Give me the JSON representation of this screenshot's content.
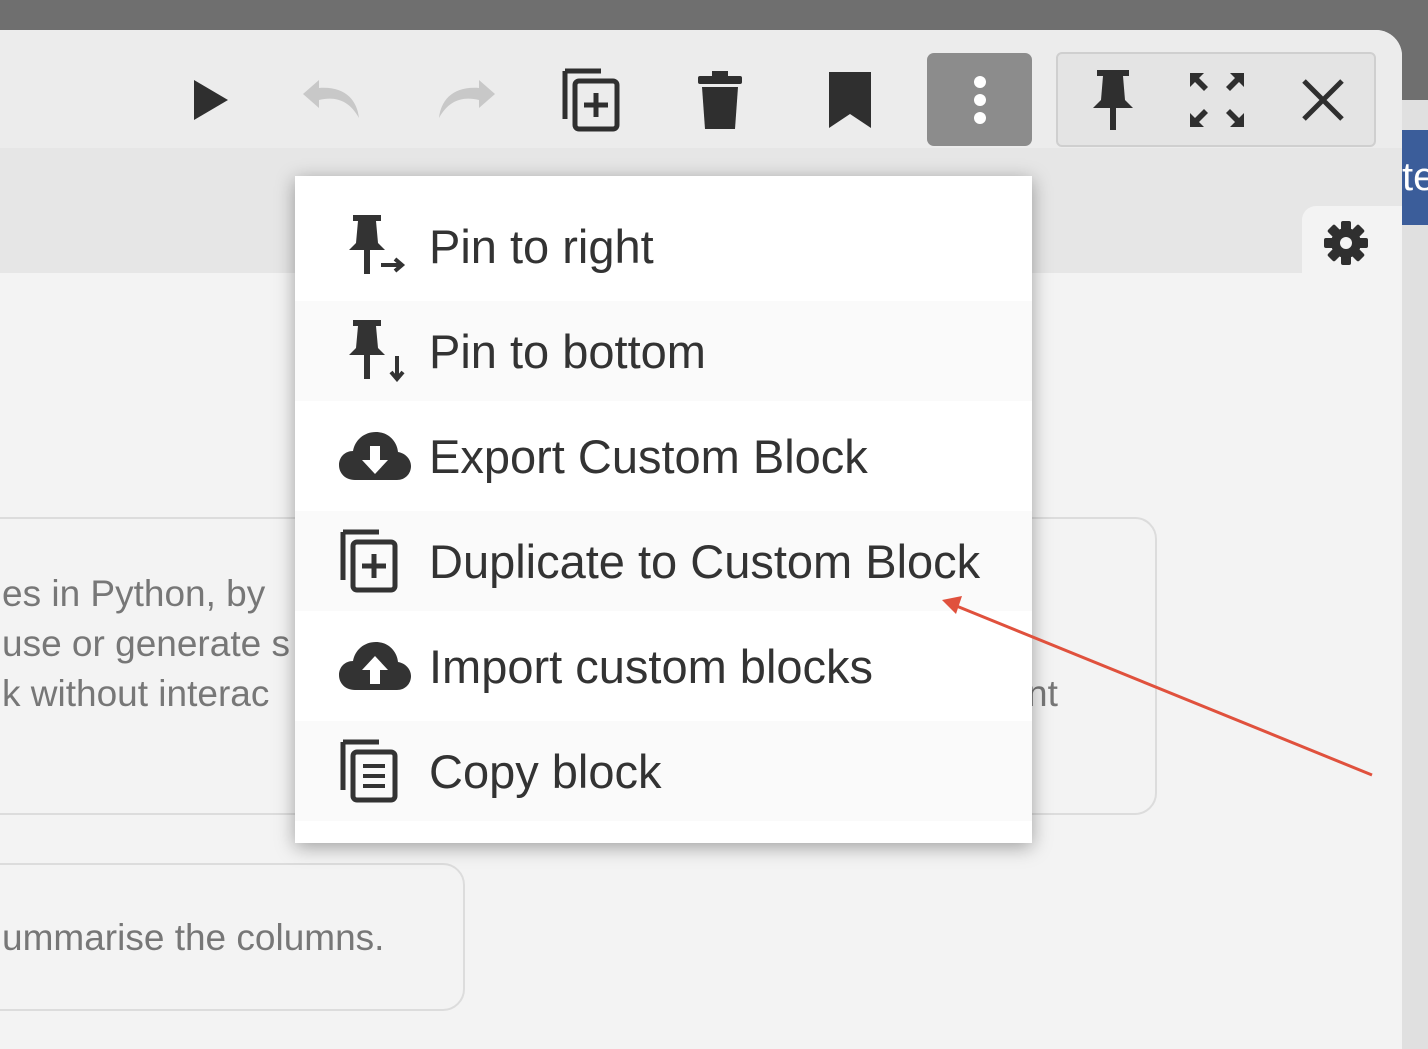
{
  "toolbar": {
    "buttons": [
      {
        "name": "run",
        "icon": "play-icon"
      },
      {
        "name": "undo",
        "icon": "undo-icon"
      },
      {
        "name": "redo",
        "icon": "redo-icon"
      },
      {
        "name": "duplicate",
        "icon": "duplicate-icon"
      },
      {
        "name": "delete",
        "icon": "trash-icon"
      },
      {
        "name": "bookmark",
        "icon": "bookmark-icon"
      },
      {
        "name": "more",
        "icon": "more-vertical-icon"
      },
      {
        "name": "pin",
        "icon": "pin-icon"
      },
      {
        "name": "expand",
        "icon": "expand-icon"
      },
      {
        "name": "close",
        "icon": "close-icon"
      }
    ]
  },
  "settings": {
    "icon": "gear-icon"
  },
  "background_cards": {
    "card1_lines": [
      "es in Python, by",
      "use or generate s",
      "k without interac"
    ],
    "card1_right_fragment": "nt",
    "card2_text": "ummarise the columns."
  },
  "side_badge": {
    "text": "te"
  },
  "menu": {
    "items": [
      {
        "label": "Pin to right",
        "icon": "pin-right-icon"
      },
      {
        "label": "Pin to bottom",
        "icon": "pin-bottom-icon"
      },
      {
        "label": "Export Custom Block",
        "icon": "cloud-download-icon"
      },
      {
        "label": "Duplicate to Custom Block",
        "icon": "duplicate-icon"
      },
      {
        "label": "Import custom blocks",
        "icon": "cloud-upload-icon"
      },
      {
        "label": "Copy block",
        "icon": "copy-icon"
      }
    ]
  },
  "colors": {
    "accent_arrow": "#e0513d",
    "more_button_active": "#8c8c8c",
    "icon_dark": "#2f2f2f",
    "icon_disabled": "#c8c8c8"
  }
}
